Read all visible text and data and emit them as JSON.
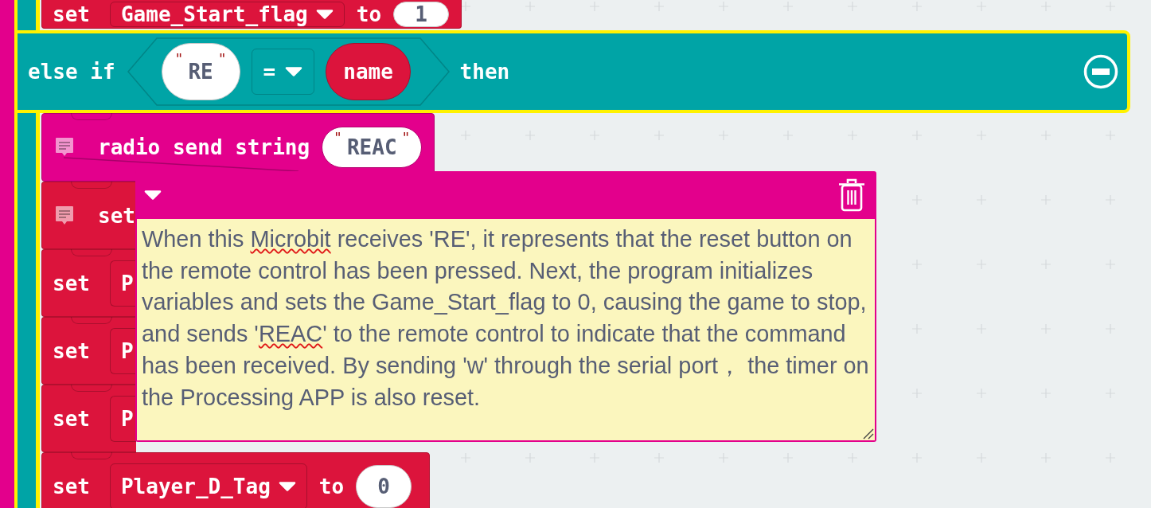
{
  "workspace": {
    "if_block": {
      "selected": true,
      "if_branch_blocks": [
        {
          "kind": "set",
          "keyword": "set",
          "variable": {
            "text": "Game_Start_flag",
            "dropdown": true
          },
          "to": "to",
          "value": "1",
          "comment": false
        }
      ],
      "else_if": {
        "label": "else if",
        "condition": {
          "left": {
            "open_quote": "\"",
            "text": "RE",
            "close_quote": "\""
          },
          "operator": "=",
          "right": "name"
        },
        "then": "then"
      },
      "else_if_branch_blocks": [
        {
          "kind": "radio_send",
          "label": "radio send string",
          "value": {
            "open_quote": "\"",
            "text": "REAC",
            "close_quote": "\""
          },
          "comment": true
        },
        {
          "kind": "set",
          "keyword": "set",
          "comment": true
        },
        {
          "kind": "set",
          "keyword": "set",
          "variable": {
            "text": "P",
            "dropdown": false
          },
          "comment": false
        },
        {
          "kind": "set",
          "keyword": "set",
          "variable": {
            "text": "P",
            "dropdown": false
          },
          "comment": false
        },
        {
          "kind": "set",
          "keyword": "set",
          "variable": {
            "text": "P",
            "dropdown": false
          },
          "comment": false
        },
        {
          "kind": "set",
          "keyword": "set",
          "variable": {
            "text": "Player_D_Tag",
            "dropdown": true
          },
          "to": "to",
          "value": "0",
          "comment": false
        }
      ]
    },
    "comment_bubble": {
      "expanded": true,
      "segments": [
        {
          "text": "When this ",
          "misspelled": false
        },
        {
          "text": "Microbit",
          "misspelled": true
        },
        {
          "text": " receives 'RE', it represents that the reset button on the remote control has been pressed. Next, the program initializes variables and sets the Game_Start_flag to 0, causing the game to stop, and sends '",
          "misspelled": false
        },
        {
          "text": "REAC",
          "misspelled": true
        },
        {
          "text": "' to the remote control to indicate that the command has been received. By sending 'w' through the serial port， the timer on the Processing APP is also reset.",
          "misspelled": false
        }
      ]
    }
  }
}
